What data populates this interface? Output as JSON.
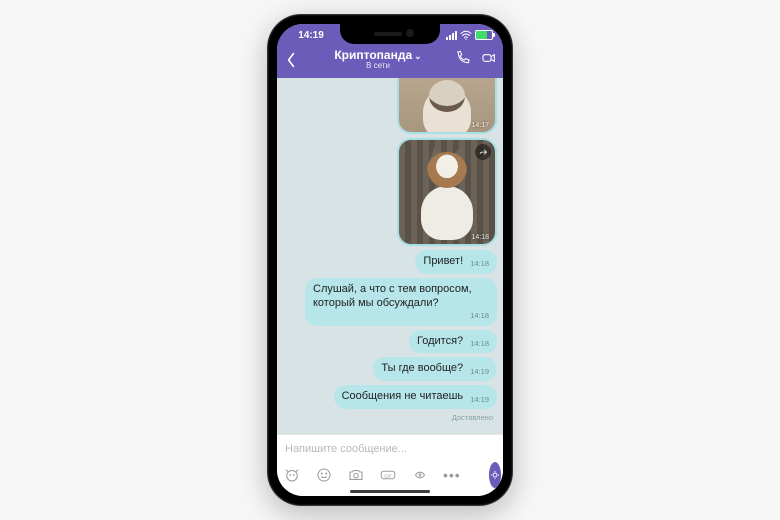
{
  "status": {
    "time": "14:19"
  },
  "header": {
    "title": "Криптопанда",
    "subtitle": "В сети"
  },
  "messages": {
    "photo1_time": "14:17",
    "photo2_time": "14:18",
    "m1": {
      "text": "Привет!",
      "time": "14:18"
    },
    "m2": {
      "text": "Слушай, а что с тем вопросом, который мы обсуждали?",
      "time": "14:18"
    },
    "m3": {
      "text": "Годится?",
      "time": "14:18"
    },
    "m4": {
      "text": "Ты где вообще?",
      "time": "14:19"
    },
    "m5": {
      "text": "Сообщения не читаешь",
      "time": "14:19"
    },
    "delivered": "Доставлено"
  },
  "composer": {
    "placeholder": "Напишите сообщение..."
  }
}
